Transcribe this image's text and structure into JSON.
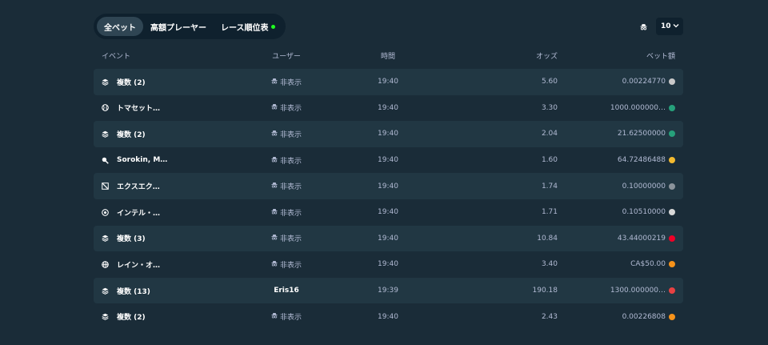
{
  "tabs": [
    {
      "label": "全ベット",
      "active": true
    },
    {
      "label": "高額プレーヤー",
      "active": false
    },
    {
      "label": "レース順位表",
      "active": false,
      "live": true
    }
  ],
  "page_size": {
    "value": "10"
  },
  "columns": {
    "event": "イベント",
    "user": "ユーザー",
    "time": "時間",
    "odds": "オッズ",
    "bet": "ベット額"
  },
  "rows": [
    {
      "event": "複数 (2)",
      "icon": "stack-icon",
      "user": "非表示",
      "hidden": true,
      "time": "19:40",
      "odds": "5.60",
      "bet": "0.00224770",
      "coin_color": "#c9c9c9"
    },
    {
      "event": "トマセット…",
      "icon": "tennis-ball-icon",
      "user": "非表示",
      "hidden": true,
      "time": "19:40",
      "odds": "3.30",
      "bet": "1000.000000…",
      "coin_color": "#26a17b"
    },
    {
      "event": "複数 (2)",
      "icon": "stack-icon",
      "user": "非表示",
      "hidden": true,
      "time": "19:40",
      "odds": "2.04",
      "bet": "21.62500000",
      "coin_color": "#26a17b"
    },
    {
      "event": "Sorokin, M…",
      "icon": "table-tennis-icon",
      "user": "非表示",
      "hidden": true,
      "time": "19:40",
      "odds": "1.60",
      "bet": "64.72486488",
      "coin_color": "#f3ba2f"
    },
    {
      "event": "エクスエク…",
      "icon": "esports-icon",
      "user": "非表示",
      "hidden": true,
      "time": "19:40",
      "odds": "1.74",
      "bet": "0.10000000",
      "coin_color": "#8a939b"
    },
    {
      "event": "インテル・…",
      "icon": "soccer-ball-icon",
      "user": "非表示",
      "hidden": true,
      "time": "19:40",
      "odds": "1.71",
      "bet": "0.10510000",
      "coin_color": "#d8d8d8"
    },
    {
      "event": "複数 (3)",
      "icon": "stack-icon",
      "user": "非表示",
      "hidden": true,
      "time": "19:40",
      "odds": "10.84",
      "bet": "43.44000219",
      "coin_color": "#ef0027"
    },
    {
      "event": "レイン・オ…",
      "icon": "basketball-icon",
      "user": "非表示",
      "hidden": true,
      "time": "19:40",
      "odds": "3.40",
      "bet": "CA$50.00",
      "coin_color": "#f7931a"
    },
    {
      "event": "複数 (13)",
      "icon": "stack-icon",
      "user": "Eris16",
      "hidden": false,
      "time": "19:39",
      "odds": "190.18",
      "bet": "1300.000000…",
      "coin_color": "#e84142"
    },
    {
      "event": "複数 (2)",
      "icon": "stack-icon",
      "user": "非表示",
      "hidden": true,
      "time": "19:40",
      "odds": "2.43",
      "bet": "0.00226808",
      "coin_color": "#f7931a"
    }
  ]
}
